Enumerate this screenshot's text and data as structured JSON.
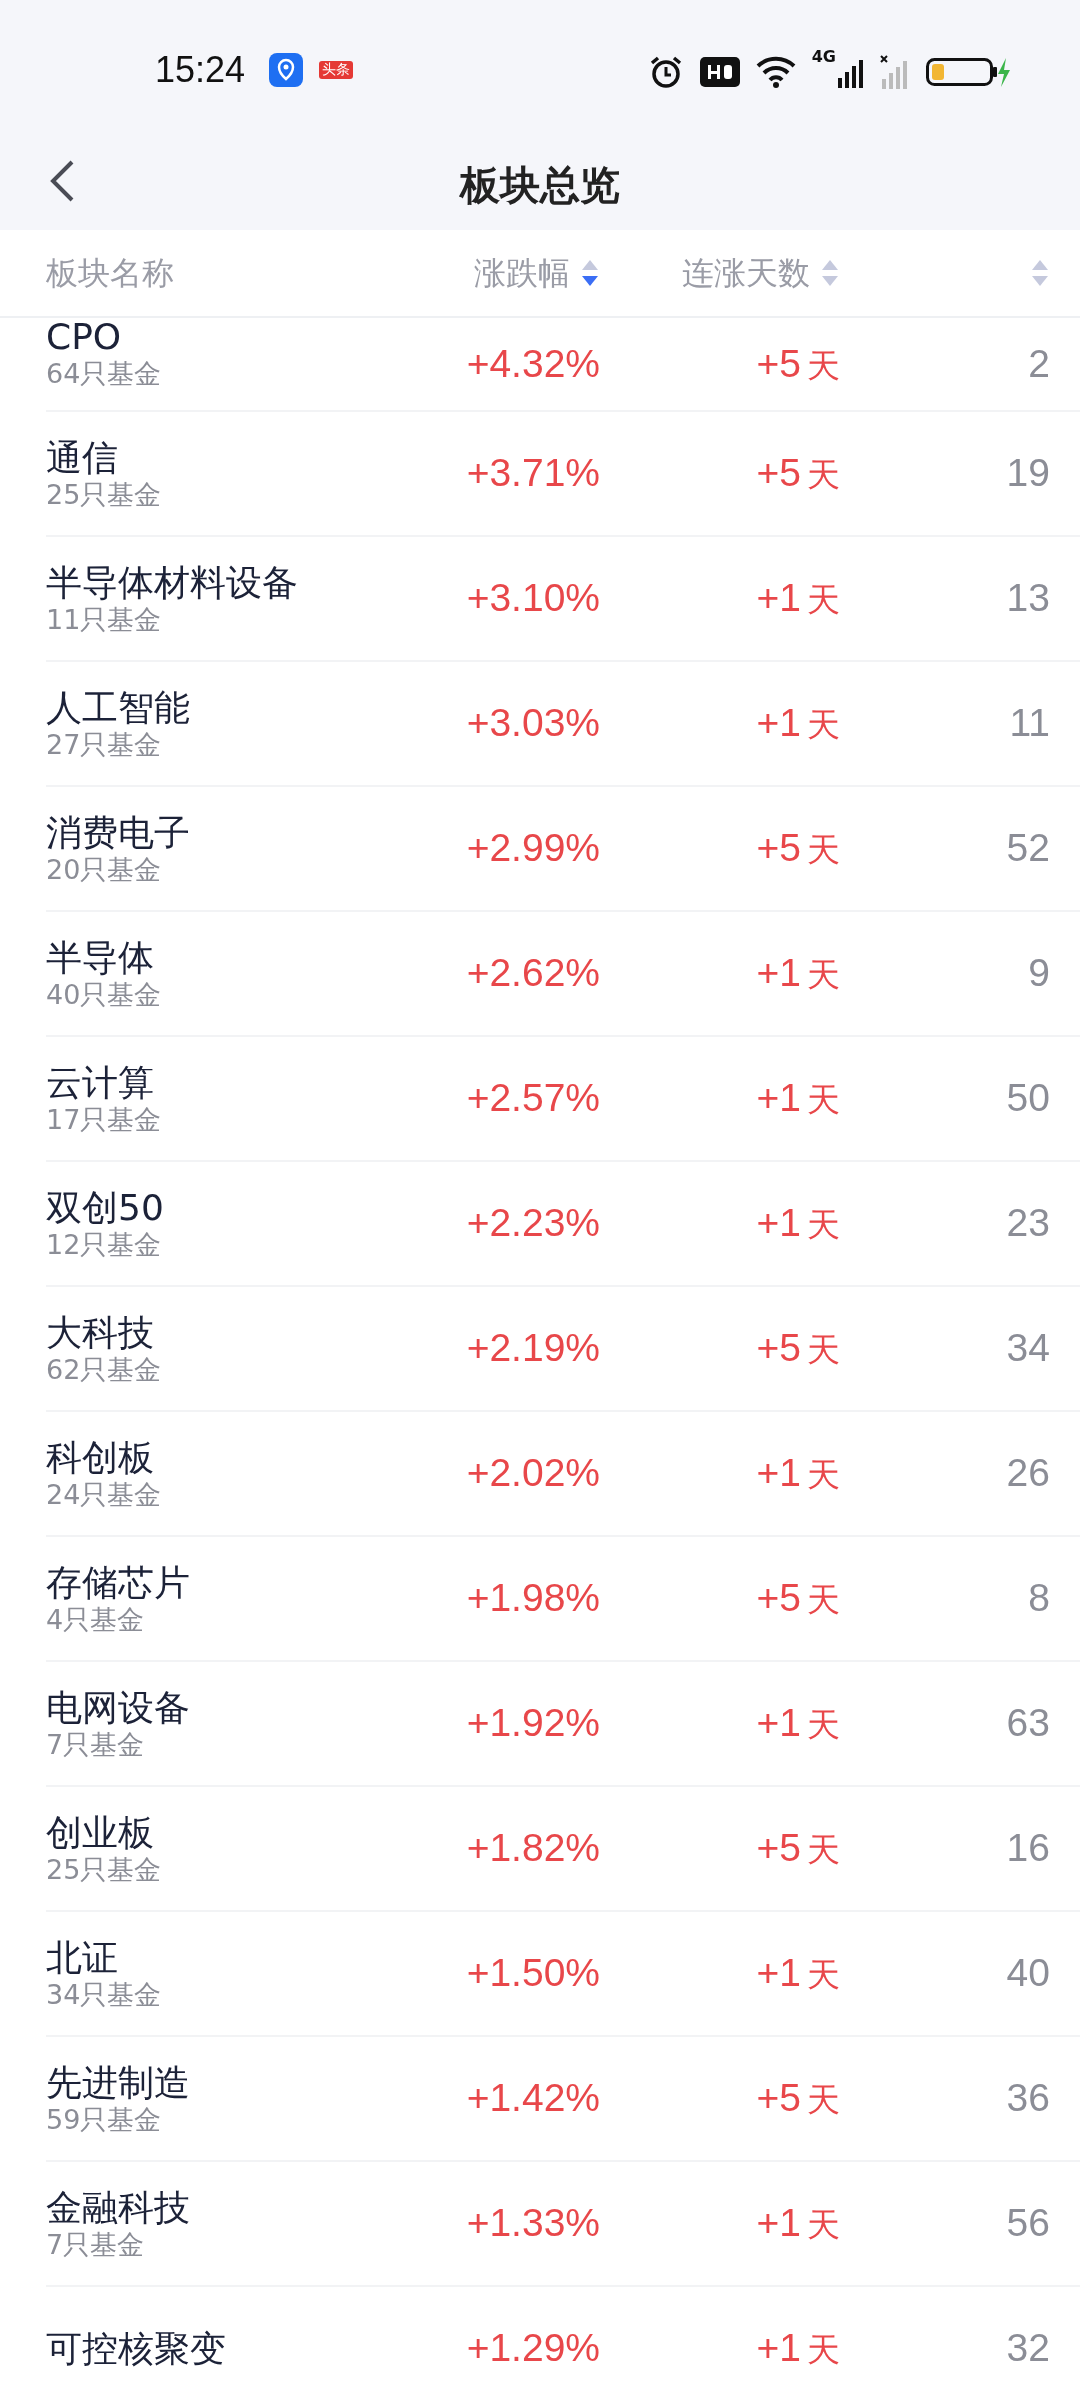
{
  "status_bar": {
    "time": "15:24",
    "notification_badge": "头条",
    "network": "4G"
  },
  "header": {
    "title": "板块总览"
  },
  "columns": [
    {
      "label": "板块名称"
    },
    {
      "label": "涨跌幅",
      "sorted": true
    },
    {
      "label": "连涨天数",
      "sorted": false
    },
    {
      "sorted": false
    }
  ],
  "rows": [
    {
      "name": "CPO",
      "funds": "64只基金",
      "change": "+4.32%",
      "streak": "+5",
      "unit": "天",
      "column_4": "2"
    },
    {
      "name": "通信",
      "funds": "25只基金",
      "change": "+3.71%",
      "streak": "+5",
      "unit": "天",
      "column_4": "19"
    },
    {
      "name": "半导体材料设备",
      "funds": "11只基金",
      "change": "+3.10%",
      "streak": "+1",
      "unit": "天",
      "column_4": "13"
    },
    {
      "name": "人工智能",
      "funds": "27只基金",
      "change": "+3.03%",
      "streak": "+1",
      "unit": "天",
      "column_4": "11"
    },
    {
      "name": "消费电子",
      "funds": "20只基金",
      "change": "+2.99%",
      "streak": "+5",
      "unit": "天",
      "column_4": "52"
    },
    {
      "name": "半导体",
      "funds": "40只基金",
      "change": "+2.62%",
      "streak": "+1",
      "unit": "天",
      "column_4": "9"
    },
    {
      "name": "云计算",
      "funds": "17只基金",
      "change": "+2.57%",
      "streak": "+1",
      "unit": "天",
      "column_4": "50"
    },
    {
      "name": "双创50",
      "funds": "12只基金",
      "change": "+2.23%",
      "streak": "+1",
      "unit": "天",
      "column_4": "23"
    },
    {
      "name": "大科技",
      "funds": "62只基金",
      "change": "+2.19%",
      "streak": "+5",
      "unit": "天",
      "column_4": "34"
    },
    {
      "name": "科创板",
      "funds": "24只基金",
      "change": "+2.02%",
      "streak": "+1",
      "unit": "天",
      "column_4": "26"
    },
    {
      "name": "存储芯片",
      "funds": "4只基金",
      "change": "+1.98%",
      "streak": "+5",
      "unit": "天",
      "column_4": "8"
    },
    {
      "name": "电网设备",
      "funds": "7只基金",
      "change": "+1.92%",
      "streak": "+1",
      "unit": "天",
      "column_4": "63"
    },
    {
      "name": "创业板",
      "funds": "25只基金",
      "change": "+1.82%",
      "streak": "+5",
      "unit": "天",
      "column_4": "16"
    },
    {
      "name": "北证",
      "funds": "34只基金",
      "change": "+1.50%",
      "streak": "+1",
      "unit": "天",
      "column_4": "40"
    },
    {
      "name": "先进制造",
      "funds": "59只基金",
      "change": "+1.42%",
      "streak": "+5",
      "unit": "天",
      "column_4": "36"
    },
    {
      "name": "金融科技",
      "funds": "7只基金",
      "change": "+1.33%",
      "streak": "+1",
      "unit": "天",
      "column_4": "56"
    },
    {
      "name": "可控核聚变",
      "change": "+1.29%",
      "streak": "+1",
      "unit": "天",
      "column_4": "32"
    }
  ]
}
